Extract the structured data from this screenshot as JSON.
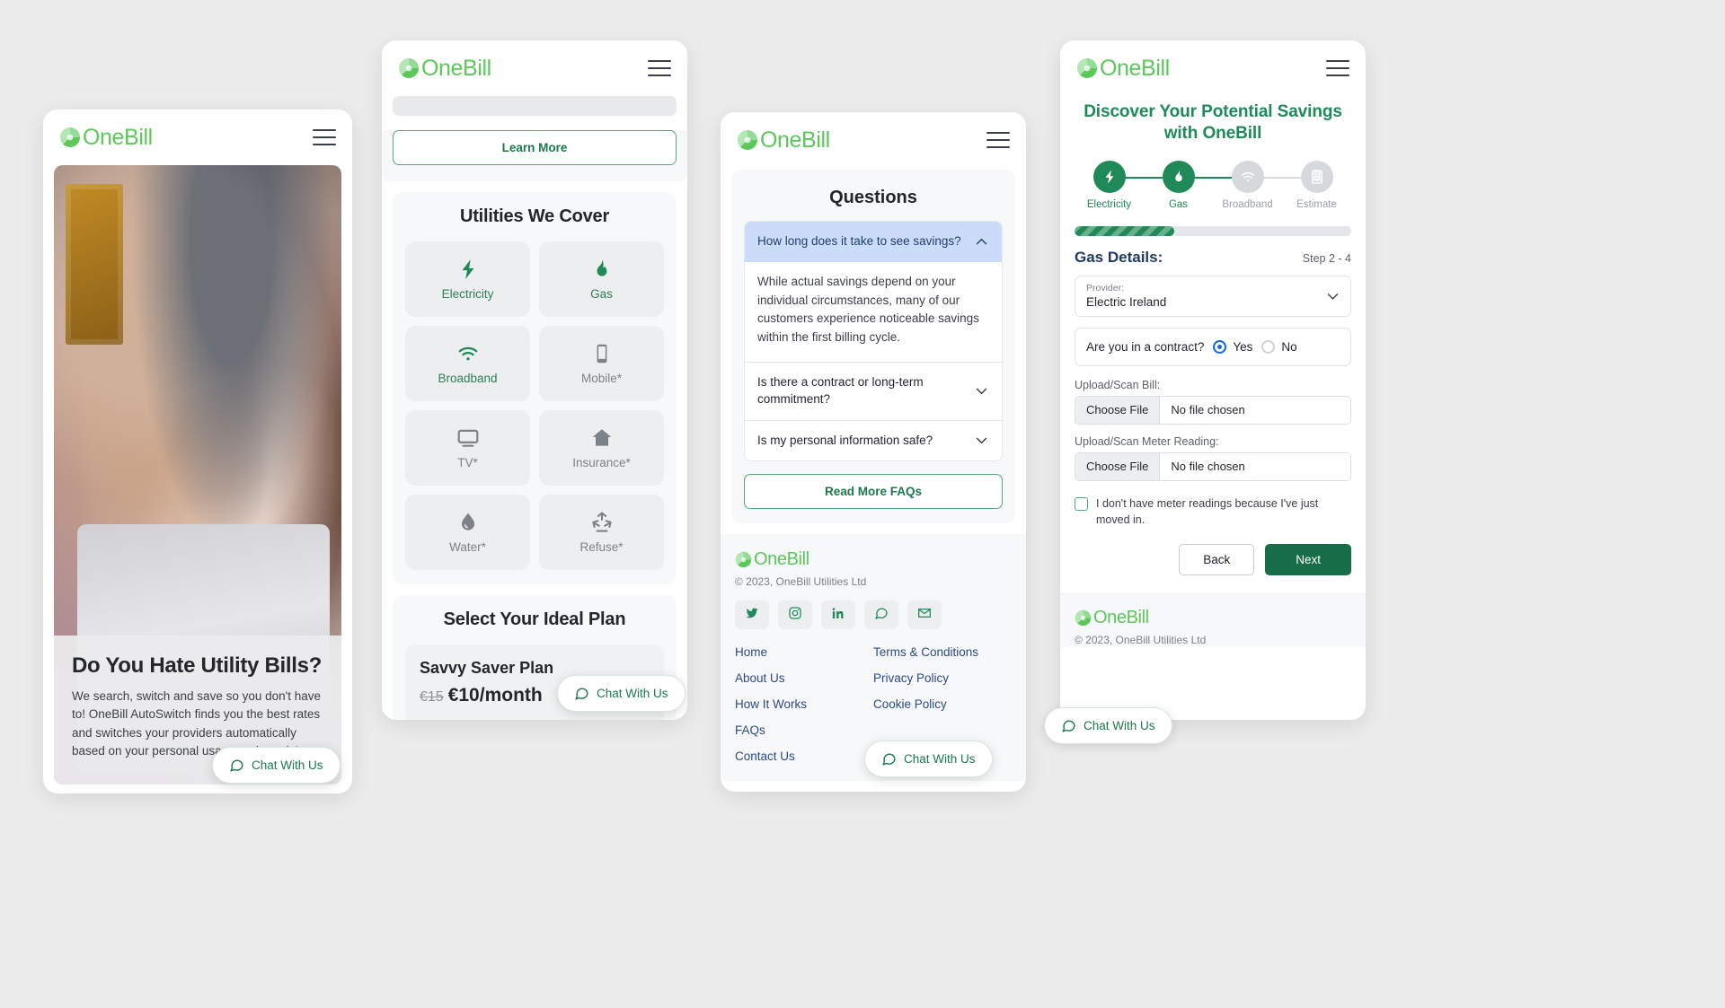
{
  "brand": {
    "name": "OneBill",
    "green": "#5cc85c",
    "dark_green": "#1f8a57"
  },
  "phone1": {
    "hero_title": "Do You Hate Utility Bills?",
    "hero_body": "We search, switch and save so you don't have to! OneBill AutoSwitch finds you the best rates and switches your providers automatically based on your personal usage and needs!",
    "chat_label": "Chat With Us"
  },
  "phone2": {
    "learn_more": "Learn More",
    "utilities_title": "Utilities We Cover",
    "utilities": [
      {
        "label": "Electricity",
        "icon": "bolt-icon",
        "available": true
      },
      {
        "label": "Gas",
        "icon": "flame-icon",
        "available": true
      },
      {
        "label": "Broadband",
        "icon": "wifi-icon",
        "available": true
      },
      {
        "label": "Mobile*",
        "icon": "mobile-icon",
        "available": false
      },
      {
        "label": "TV*",
        "icon": "tv-icon",
        "available": false
      },
      {
        "label": "Insurance*",
        "icon": "home-icon",
        "available": false
      },
      {
        "label": "Water*",
        "icon": "droplet-icon",
        "available": false
      },
      {
        "label": "Refuse*",
        "icon": "recycle-icon",
        "available": false
      }
    ],
    "plan_title": "Select Your Ideal Plan",
    "plan_name": "Savvy Saver Plan",
    "plan_old_price": "€15",
    "plan_price": "€10/month",
    "chat_label": "Chat With Us"
  },
  "phone3": {
    "faq_title": "Questions",
    "faq": [
      {
        "question": "How long does it take to see savings?",
        "answer": "While actual savings depend on your individual circumstances, many of our customers experience noticeable savings within the first billing cycle.",
        "open": true
      },
      {
        "question": "Is there a contract or long-term commitment?",
        "answer": "",
        "open": false
      },
      {
        "question": "Is my personal information safe?",
        "answer": "",
        "open": false
      }
    ],
    "read_more": "Read More FAQs",
    "footer": {
      "copyright": "© 2023, OneBill Utilities Ltd",
      "socials": [
        "twitter-icon",
        "instagram-icon",
        "linkedin-icon",
        "whatsapp-icon",
        "email-icon"
      ],
      "links_left": [
        "Home",
        "About Us",
        "How It Works",
        "FAQs",
        "Contact Us"
      ],
      "links_right": [
        "Terms & Conditions",
        "Privacy Policy",
        "Cookie Policy"
      ]
    },
    "chat_label": "Chat With Us"
  },
  "phone4": {
    "title": "Discover Your Potential Savings with OneBill",
    "steps": [
      {
        "label": "Electricity",
        "icon": "bolt-icon",
        "active": true
      },
      {
        "label": "Gas",
        "icon": "flame-icon",
        "active": true
      },
      {
        "label": "Broadband",
        "icon": "wifi-icon",
        "active": false
      },
      {
        "label": "Estimate",
        "icon": "calculator-icon",
        "active": false
      }
    ],
    "progress_percent": 36,
    "section_title": "Gas Details:",
    "step_count": "Step 2 - 4",
    "provider_label": "Provider:",
    "provider_value": "Electric Ireland",
    "contract_question": "Are you in a contract?",
    "contract_yes": "Yes",
    "contract_no": "No",
    "contract_selected": "Yes",
    "upload_bill_label": "Upload/Scan Bill:",
    "upload_meter_label": "Upload/Scan Meter Reading:",
    "choose_file": "Choose File",
    "no_file": "No file chosen",
    "no_meter_checkbox": "I don't have meter readings because I've just moved in.",
    "back": "Back",
    "next": "Next",
    "footer_copyright": "© 2023, OneBill Utilities Ltd",
    "chat_label": "Chat With Us"
  }
}
